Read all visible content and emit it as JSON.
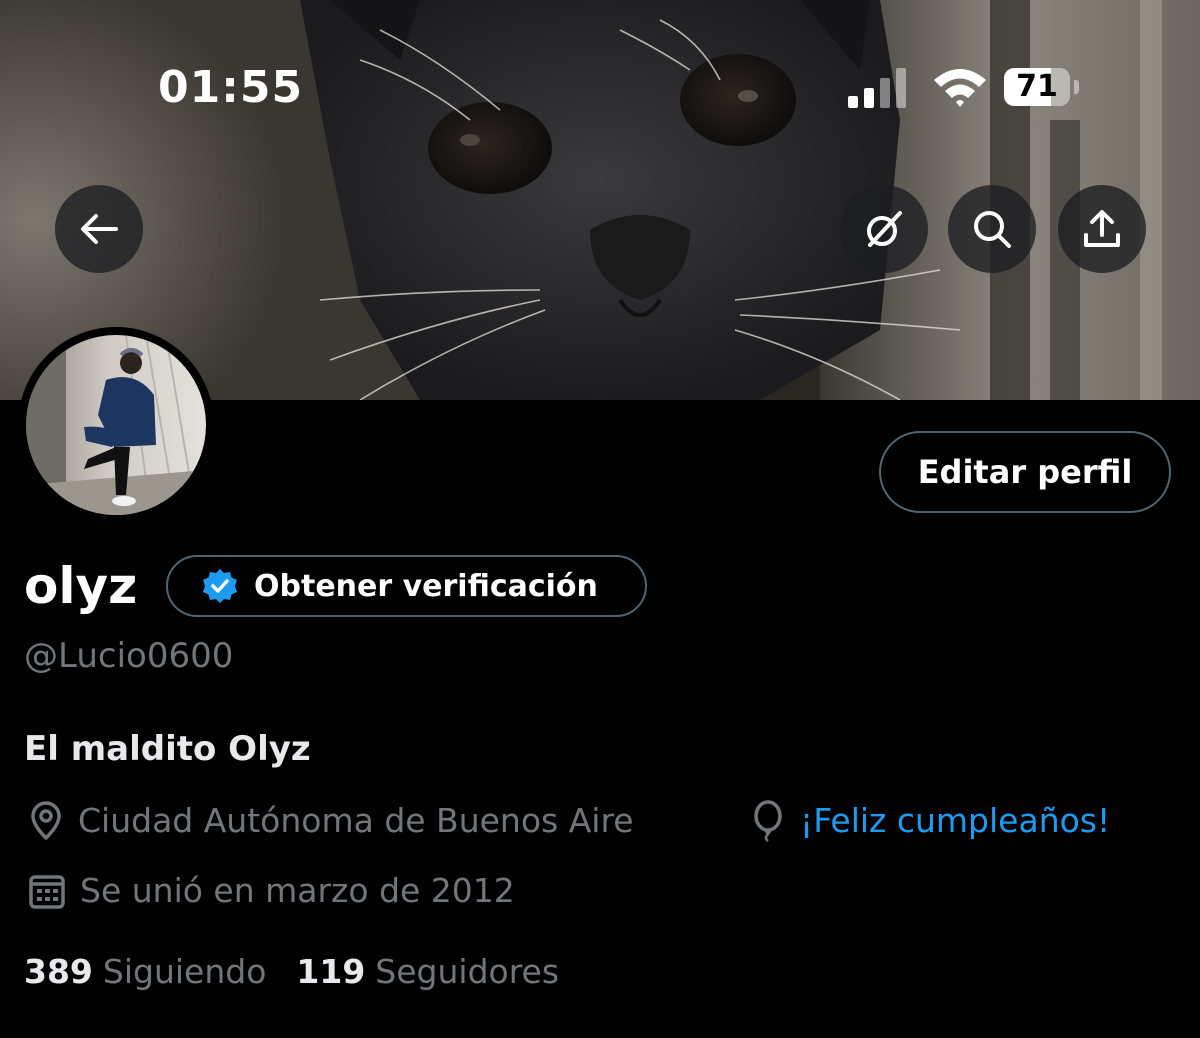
{
  "status_bar": {
    "time": "01:55",
    "battery": "71",
    "battery_level": 0.71
  },
  "banner": {
    "description": "cat-photo"
  },
  "header_buttons": {
    "back_icon": "arrow-left-icon",
    "grok_icon": "grok-icon",
    "search_icon": "search-icon",
    "share_icon": "share-icon"
  },
  "profile": {
    "edit_label": "Editar perfil",
    "display_name": "olyz",
    "verify_label": "Obtener verificación",
    "handle": "@Lucio0600",
    "bio": "El maldito Olyz",
    "location": "Ciudad Autónoma de Buenos Aire",
    "birthday": "¡Feliz cumpleaños!",
    "joined": "Se unió en marzo de 2012",
    "following_count": "389",
    "following_label": "Siguiendo",
    "followers_count": "119",
    "followers_label": "Seguidores"
  },
  "colors": {
    "background": "#000000",
    "accent": "#1d9bf0",
    "secondary_text": "#71767b",
    "border": "#536471"
  }
}
